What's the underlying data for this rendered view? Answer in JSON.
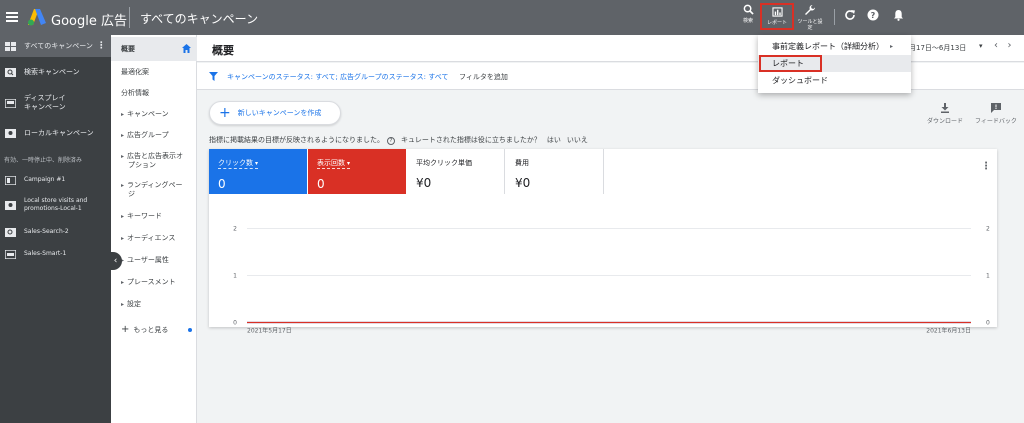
{
  "topbar": {
    "app_title": "Google 広告",
    "page_heading": "すべてのキャンペーン",
    "search_label": "検索",
    "report_label": "レポート",
    "tools_label": "ツールと設定"
  },
  "leftnav": {
    "all_campaigns": "すべてのキャンペーン",
    "search_campaign": "検索キャンペーン",
    "display_campaign_1": "ディスプレイ",
    "display_campaign_2": "キャンペーン",
    "local_campaign": "ローカルキャンペーン",
    "section_label": "有効、一時停止中、削除済み",
    "campaigns": [
      {
        "label": "Campaign #1"
      },
      {
        "label_1": "Local store visits and",
        "label_2": "promotions-Local-1"
      },
      {
        "label": "Sales-Search-2"
      },
      {
        "label": "Sales-Smart-1"
      }
    ]
  },
  "subnav": {
    "overview": "概要",
    "recommendations": "最適化案",
    "insights": "分析情報",
    "campaigns": "キャンペーン",
    "ad_groups": "広告グループ",
    "ads_ext_1": "広告と広告表示オ",
    "ads_ext_2": "プション",
    "landing_1": "ランディングペー",
    "landing_2": "ジ",
    "keywords": "キーワード",
    "audiences": "オーディエンス",
    "demographics": "ユーザー属性",
    "placements": "プレースメント",
    "settings": "設定",
    "more": "もっと見る"
  },
  "main": {
    "title": "概要",
    "date_range": "月17日～6月13日",
    "filter_text": "キャンペーンのステータス: すべて; 広告グループのステータス: すべて",
    "filter_add": "フィルタを追加",
    "new_campaign": "新しいキャンペーンを作成",
    "download": "ダウンロード",
    "feedback": "フィードバック",
    "question": "指標に掲載結果の目標が反映されるようになりました。",
    "question2": "キュレートされた指標は役に立ちましたか？",
    "yes": "はい",
    "no": "いいえ"
  },
  "metrics": [
    {
      "label": "クリック数",
      "value": "0"
    },
    {
      "label": "表示回数",
      "value": "0"
    },
    {
      "label": "平均クリック単価",
      "value": "¥0"
    },
    {
      "label": "費用",
      "value": "¥0"
    }
  ],
  "menu": {
    "item1": "事前定義レポート（詳細分析）",
    "item2": "レポート",
    "item3": "ダッシュボード"
  },
  "colors": {
    "clicks": "#1a73e8",
    "impressions": "#d93025"
  },
  "chart_data": {
    "type": "line",
    "x": [
      "2021年5月17日",
      "2021年6月13日"
    ],
    "x_tick_labels": [
      "2021年5月17日",
      "2021年6月13日"
    ],
    "y_ticks": [
      0,
      1,
      2
    ],
    "y_ticks_right": [
      0,
      1,
      2
    ],
    "ylim": [
      0,
      2
    ],
    "grid": true,
    "series": [
      {
        "name": "クリック数",
        "values": [
          0,
          0
        ],
        "color": "#1a73e8"
      },
      {
        "name": "表示回数",
        "values": [
          0,
          0
        ],
        "color": "#d93025"
      }
    ]
  }
}
